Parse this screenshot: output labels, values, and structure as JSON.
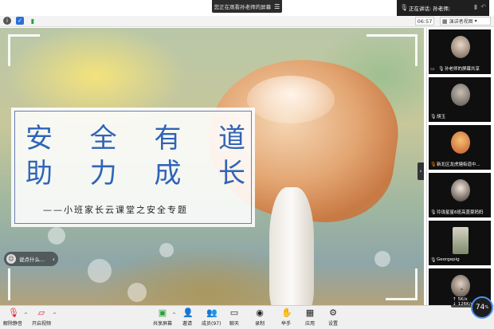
{
  "banner": {
    "text": "您正在观看孙老师的屏幕"
  },
  "speaking": {
    "text": "正在讲话: 孙老师;"
  },
  "topbar": {
    "time": "06:57",
    "view_label": "演讲者视图"
  },
  "slide": {
    "title_line1": [
      "安",
      "全",
      "有",
      "道"
    ],
    "title_line2": [
      "助",
      "力",
      "成",
      "长"
    ],
    "subtitle": "——小班家长云课堂之安全专题"
  },
  "chat": {
    "placeholder": "说点什么..."
  },
  "participants": [
    {
      "name": "孙老师的屏幕共享",
      "mic": "on",
      "sharing": true
    },
    {
      "name": "胡玉",
      "mic": "on",
      "sharing": false
    },
    {
      "name": "新北区龙虎塘街道中...",
      "mic": "orange",
      "sharing": false
    },
    {
      "name": "玲珑星星6班高盖豪妈妈",
      "mic": "on",
      "sharing": false
    },
    {
      "name": "Georgepig",
      "mic": "on",
      "sharing": false
    },
    {
      "name": "",
      "mic": "on",
      "sharing": false
    }
  ],
  "metrics": {
    "upload": "5K/s",
    "download": "126K/s"
  },
  "gauge": {
    "value": "74",
    "unit": "%"
  },
  "bottom": {
    "mute": "解除静音",
    "video": "开启视频",
    "share": "共享屏幕",
    "invite": "邀请",
    "members": "成员(97)",
    "chat": "聊天",
    "record": "录制",
    "hand": "举手",
    "apps": "应用",
    "settings": "设置"
  },
  "colors": {
    "title_blue": "#2f64b8",
    "mic_orange": "#ff8a00",
    "accent_blue": "#2b6fd6"
  },
  "icons": [
    "info-icon",
    "shield-icon",
    "signal-icon",
    "grid-icon",
    "menu-icon",
    "mic-icon",
    "video-off-icon",
    "screen-share-icon",
    "invite-icon",
    "members-icon",
    "chat-icon",
    "record-icon",
    "hand-icon",
    "apps-icon",
    "gear-icon"
  ]
}
